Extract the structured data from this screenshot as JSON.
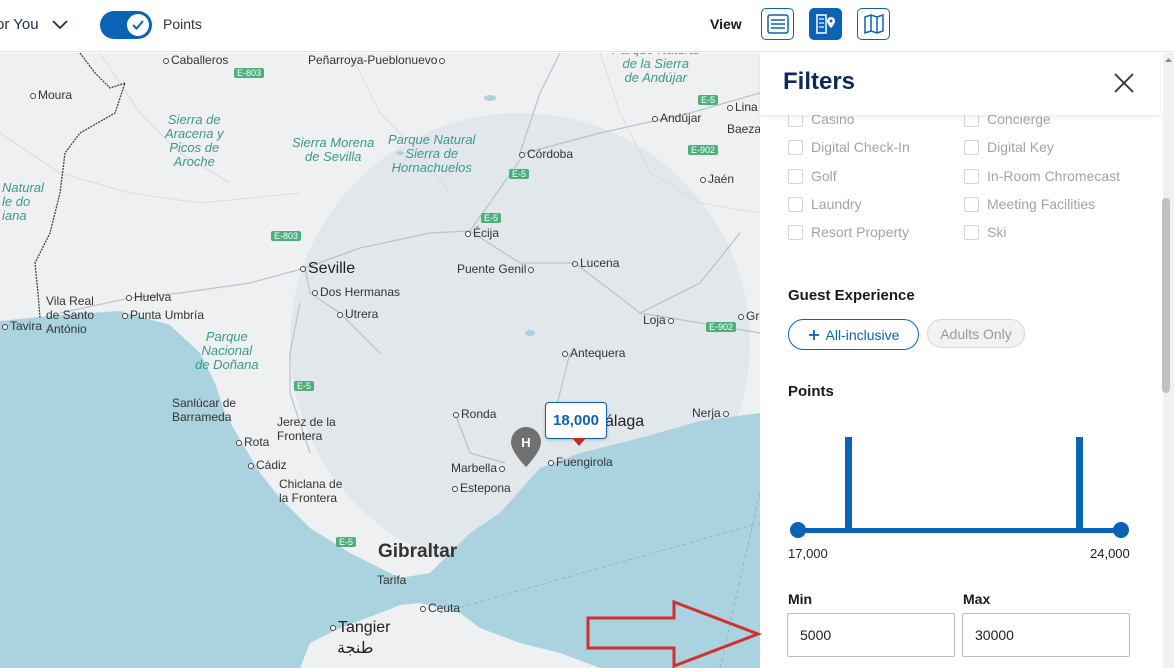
{
  "topbar": {
    "for_you_label": "or You",
    "toggle_label": "Points",
    "view_label": "View",
    "view_buttons": [
      {
        "icon": "list-icon",
        "active": false
      },
      {
        "icon": "list-map-pin-icon",
        "active": true
      },
      {
        "icon": "map-icon",
        "active": false
      }
    ]
  },
  "map": {
    "places": {
      "caballeros": "Caballeros",
      "penarroya": "Peñarroya-Pueblonuevo",
      "moura": "Moura",
      "sierra_aracena": "Sierra de\nAracena y\nPicos de\nAroche",
      "sierra_morena": "Sierra Morena\nde Sevilla",
      "parque_hornachuelos": "Parque Natural\nSierra de\nHornachuelos",
      "parque_andujar": "Parque Natural\nde la Sierra\nde Andújar",
      "natural_left": "Natural\nle do\niana",
      "andujar": "Andújar",
      "linares": "Lina",
      "baeza": "Baeza",
      "cordoba": "Córdoba",
      "jaen": "Jaén",
      "ecija": "Écija",
      "seville": "Seville",
      "dos_hermanas": "Dos Hermanas",
      "puente_genil": "Puente Genil",
      "lucena": "Lucena",
      "vila_real": "Vila Real\nde Santo\nAntónio",
      "tavira": "Tavira",
      "huelva": "Huelva",
      "punta_umbria": "Punta Umbría",
      "utrera": "Utrera",
      "loja": "Loja",
      "granada": "Gra",
      "parque_donana": "Parque\nNacional\nde Doñana",
      "antequera": "Antequera",
      "sanlucar": "Sanlúcar de\nBarrameda",
      "jerez": "Jerez de la\nFrontera",
      "ronda": "Ronda",
      "malaga": "álaga",
      "nerja": "Nerja",
      "rota": "Rota",
      "cadiz": "Cádiz",
      "marbella": "Marbella",
      "fuengirola": "Fuengirola",
      "chiclana": "Chiclana de\nla Frontera",
      "estepona": "Estepona",
      "gibraltar": "Gibraltar",
      "tarifa": "Tarifa",
      "ceuta": "Ceuta",
      "tangier": "Tangier",
      "tangier_ar": "طنجة"
    },
    "roads": {
      "e803a": "E-803",
      "e803b": "E-803",
      "e5a": "E-5",
      "e5b": "E-5",
      "e5c": "E-5",
      "e5d": "E-5",
      "e5e": "E-5",
      "e902a": "E-902",
      "e902b": "E-902"
    },
    "price_tag": "18,000",
    "hotel_pin_letter": "H"
  },
  "filters": {
    "title": "Filters",
    "amenities": [
      {
        "label": "Casino",
        "checked": false
      },
      {
        "label": "Concierge",
        "checked": false
      },
      {
        "label": "Digital Check-In",
        "checked": false
      },
      {
        "label": "Digital Key",
        "checked": false
      },
      {
        "label": "Golf",
        "checked": false
      },
      {
        "label": "In-Room Chromecast",
        "checked": false
      },
      {
        "label": "Laundry",
        "checked": false
      },
      {
        "label": "Meeting Facilities",
        "checked": false
      },
      {
        "label": "Resort Property",
        "checked": false
      },
      {
        "label": "Ski",
        "checked": false
      }
    ],
    "guest_experience": {
      "title": "Guest Experience",
      "chips": [
        {
          "label": "All-inclusive",
          "icon": "plus-icon",
          "selected": false
        },
        {
          "label": "Adults Only",
          "disabled": true
        }
      ]
    },
    "points": {
      "title": "Points",
      "range_min_label": "17,000",
      "range_max_label": "24,000",
      "min_label": "Min",
      "max_label": "Max",
      "min_value": "5000",
      "max_value": "30000"
    }
  },
  "colors": {
    "brand_blue": "#0b63b5",
    "title_navy": "#0d2a5c",
    "arrow_red": "#d32f2f",
    "water": "#aad3df",
    "land": "#eef0f2"
  }
}
